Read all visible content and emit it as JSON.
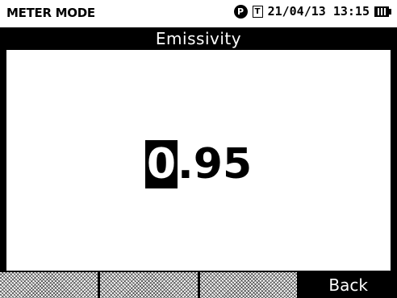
{
  "status_bar": {
    "mode": "METER MODE",
    "p_icon": "P",
    "t_icon": "T",
    "datetime": "21/04/13 13:15",
    "battery_icon": "battery-icon"
  },
  "title": "Emissivity",
  "value": {
    "selected_digit": "0",
    "rest": ".95"
  },
  "softkeys": [
    "",
    "",
    "",
    "Back"
  ],
  "colors": {
    "background": "#000000",
    "panel": "#ffffff",
    "text": "#000000"
  }
}
